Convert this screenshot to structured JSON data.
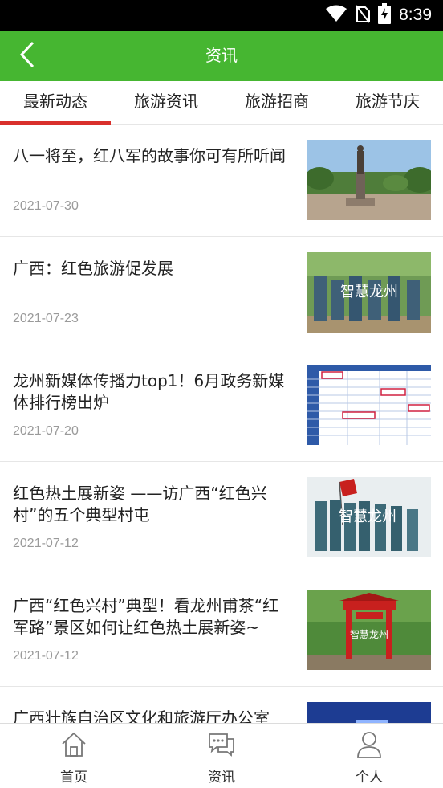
{
  "status_bar": {
    "time": "8:39",
    "icons": [
      "wifi-icon",
      "no-sim-icon",
      "battery-charging-icon"
    ]
  },
  "header": {
    "title": "资讯",
    "back_icon": "chevron-left-icon"
  },
  "colors": {
    "header_bg": "#46b631",
    "tab_indicator": "#d9302c",
    "date_text": "#9a9a9a"
  },
  "tabs": [
    {
      "label": "最新动态",
      "active": true
    },
    {
      "label": "旅游资讯",
      "active": false
    },
    {
      "label": "旅游招商",
      "active": false
    },
    {
      "label": "旅游节庆",
      "active": false
    }
  ],
  "articles": [
    {
      "title": "八一将至，红八军的故事你可有所听闻",
      "date": "2021-07-30",
      "thumbnail": "statue-plaza-photo"
    },
    {
      "title": "广西：红色旅游促发展",
      "date": "2021-07-23",
      "thumbnail": "red-army-march-photo"
    },
    {
      "title": "龙州新媒体传播力top1！6月政务新媒体排行榜出炉",
      "date": "2021-07-20",
      "thumbnail": "ranking-table-image"
    },
    {
      "title": "红色热土展新姿 ——访广西“红色兴村”的五个典型村屯",
      "date": "2021-07-12",
      "thumbnail": "red-flag-procession-photo"
    },
    {
      "title": "广西“红色兴村”典型！看龙州甫茶“红军路”景区如何让红色热土展新姿~",
      "date": "2021-07-12",
      "thumbnail": "red-gate-scenic-photo"
    },
    {
      "title": "广西壮族自治区文化和旅游厅办公室",
      "date": "",
      "thumbnail": "blue-banner-image"
    }
  ],
  "thumb_watermark": "智慧龙州",
  "bottom_nav": [
    {
      "label": "首页",
      "icon": "home-icon"
    },
    {
      "label": "资讯",
      "icon": "chat-icon"
    },
    {
      "label": "个人",
      "icon": "person-icon"
    }
  ]
}
